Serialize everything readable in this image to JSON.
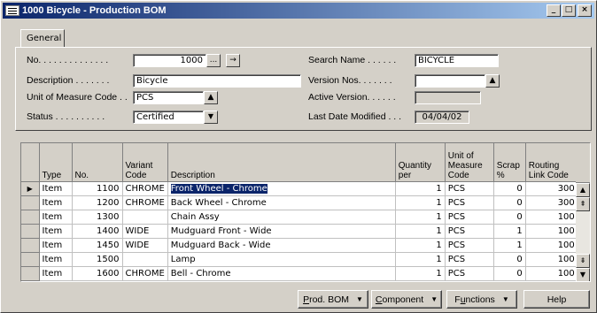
{
  "window": {
    "title": "1000 Bicycle - Production BOM",
    "minimize": "_",
    "maximize": "□",
    "close": "×"
  },
  "tab": {
    "label": "General"
  },
  "form": {
    "no": {
      "label": "No. . . . . . . . . . . . . .",
      "value": "1000",
      "assist": "...",
      "nav": "→"
    },
    "description": {
      "label": "Description . . . . . . .",
      "value": "Bicycle"
    },
    "uom": {
      "label": "Unit of Measure Code . .",
      "value": "PCS"
    },
    "status": {
      "label": "Status . . . . . . . . . .",
      "value": "Certified"
    },
    "search_name": {
      "label": "Search Name . . . . . .",
      "value": "BICYCLE"
    },
    "version_nos": {
      "label": "Version Nos. . . . . . .",
      "value": ""
    },
    "active_version": {
      "label": "Active Version. . . . . .",
      "value": ""
    },
    "last_modified": {
      "label": "Last Date Modified . . .",
      "value": "04/04/02"
    }
  },
  "table": {
    "columns": [
      "Type",
      "No.",
      "Variant Code",
      "Description",
      "Quantity per",
      "Unit of Measure Code",
      "Scrap %",
      "Routing Link Code"
    ],
    "rows": [
      {
        "type": "Item",
        "no": "1100",
        "variant": "CHROME",
        "desc": "Front Wheel - Chrome",
        "qty": "1",
        "uom": "PCS",
        "scrap": "0",
        "routing": "300"
      },
      {
        "type": "Item",
        "no": "1200",
        "variant": "CHROME",
        "desc": "Back Wheel - Chrome",
        "qty": "1",
        "uom": "PCS",
        "scrap": "0",
        "routing": "300"
      },
      {
        "type": "Item",
        "no": "1300",
        "variant": "",
        "desc": "Chain Assy",
        "qty": "1",
        "uom": "PCS",
        "scrap": "0",
        "routing": "100"
      },
      {
        "type": "Item",
        "no": "1400",
        "variant": "WIDE",
        "desc": "Mudguard Front - Wide",
        "qty": "1",
        "uom": "PCS",
        "scrap": "1",
        "routing": "100"
      },
      {
        "type": "Item",
        "no": "1450",
        "variant": "WIDE",
        "desc": "Mudguard Back - Wide",
        "qty": "1",
        "uom": "PCS",
        "scrap": "1",
        "routing": "100"
      },
      {
        "type": "Item",
        "no": "1500",
        "variant": "",
        "desc": "Lamp",
        "qty": "1",
        "uom": "PCS",
        "scrap": "0",
        "routing": "100"
      },
      {
        "type": "Item",
        "no": "1600",
        "variant": "CHROME",
        "desc": "Bell - Chrome",
        "qty": "1",
        "uom": "PCS",
        "scrap": "0",
        "routing": "100"
      }
    ]
  },
  "buttons": {
    "prod_bom": {
      "mnemonic": "P",
      "rest": "rod. BOM"
    },
    "component": {
      "mnemonic": "C",
      "rest": "omponent"
    },
    "functions": {
      "pre": "F",
      "mnemonic": "u",
      "rest": "nctions"
    },
    "help": "Help"
  },
  "colors": {
    "titlebar": "#0a246a",
    "selection": "#0a246a",
    "face": "#d4d0c8"
  }
}
